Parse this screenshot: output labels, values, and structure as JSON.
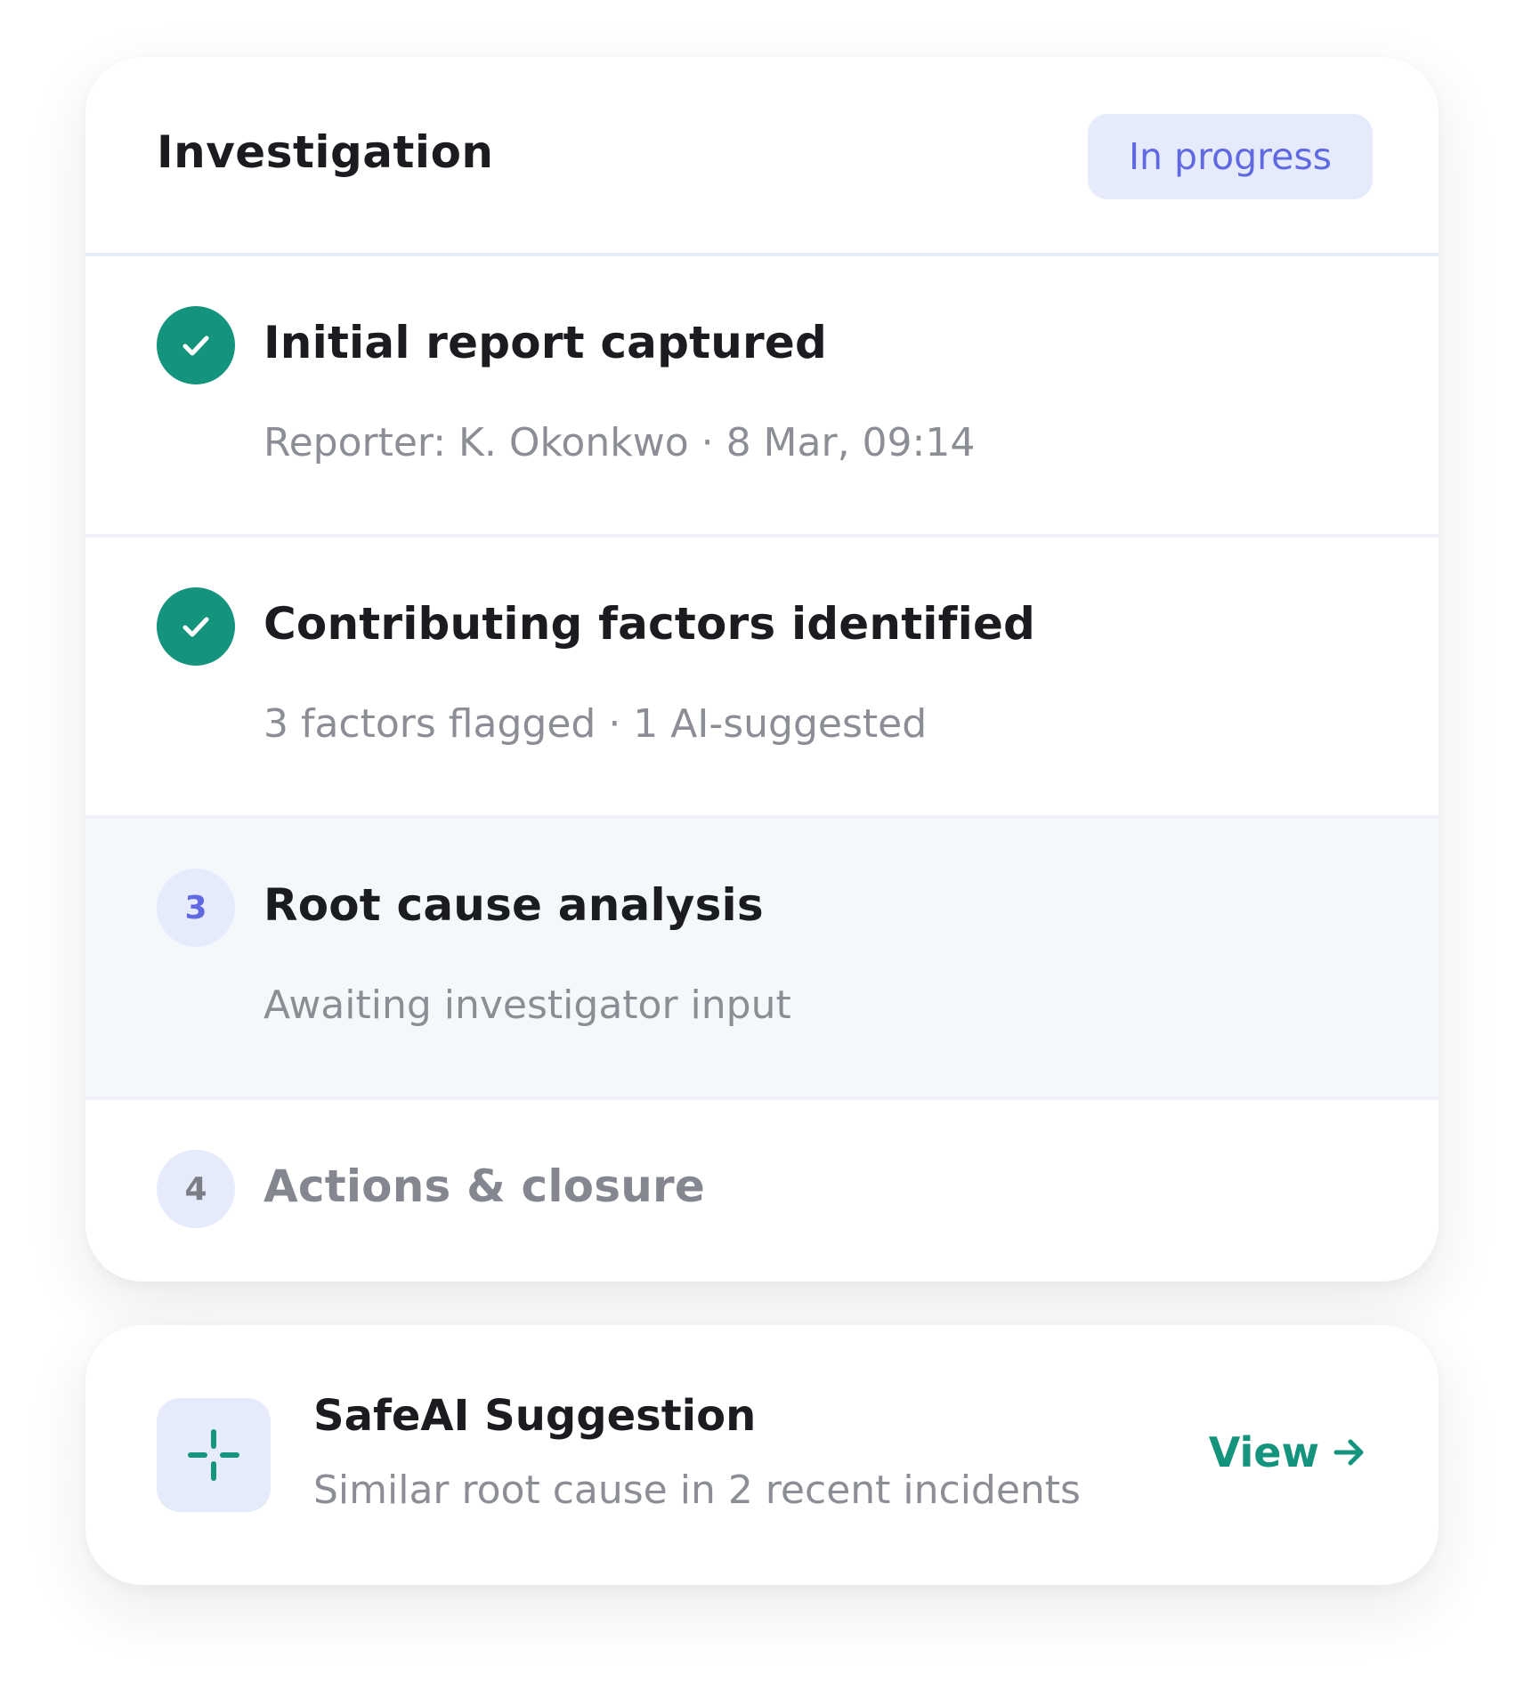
{
  "investigation": {
    "title": "Investigation",
    "status": "In progress",
    "colors": {
      "accent_indigo": "#6068e2",
      "badge_bg": "#e5ebfa",
      "done_green": "#14937d",
      "active_row_bg": "#f5f8fa"
    },
    "steps": [
      {
        "state": "done",
        "icon": "check-icon",
        "title": "Initial report captured",
        "subtitle": "Reporter: K. Okonkwo · 8 Mar, 09:14"
      },
      {
        "state": "done",
        "icon": "check-icon",
        "title": "Contributing factors identified",
        "subtitle": "3 factors flagged · 1 AI-suggested"
      },
      {
        "state": "active",
        "number": "3",
        "title": "Root cause analysis",
        "subtitle": "Awaiting investigator input"
      },
      {
        "state": "upcoming",
        "number": "4",
        "title": "Actions & closure"
      }
    ]
  },
  "suggestion": {
    "icon": "sparkle-icon",
    "title": "SafeAI Suggestion",
    "subtitle": "Similar root cause in 2 recent incidents",
    "action_label": "View",
    "action_icon": "arrow-right-icon"
  }
}
